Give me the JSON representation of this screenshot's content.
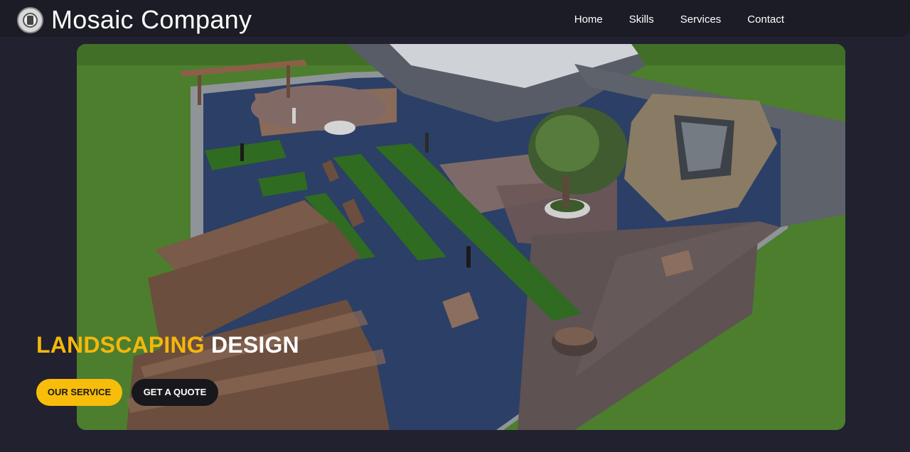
{
  "brand": {
    "name": "Mosaic Company",
    "logo_icon": "company-seal-icon"
  },
  "nav": {
    "items": [
      {
        "label": "Home"
      },
      {
        "label": "Skills"
      },
      {
        "label": "Services"
      },
      {
        "label": "Contact"
      }
    ]
  },
  "hero": {
    "headline_accent": "LANDSCAPING",
    "headline_rest": "DESIGN",
    "primary_button": "OUR SERVICE",
    "secondary_button": "GET A QUOTE",
    "image_subject": "landscape-rooftop-garden-render"
  },
  "colors": {
    "background": "#212130",
    "navbar": "#1c1c27",
    "accent": "#f5b70b",
    "text": "#ffffff",
    "secondary_button": "#17171c"
  }
}
